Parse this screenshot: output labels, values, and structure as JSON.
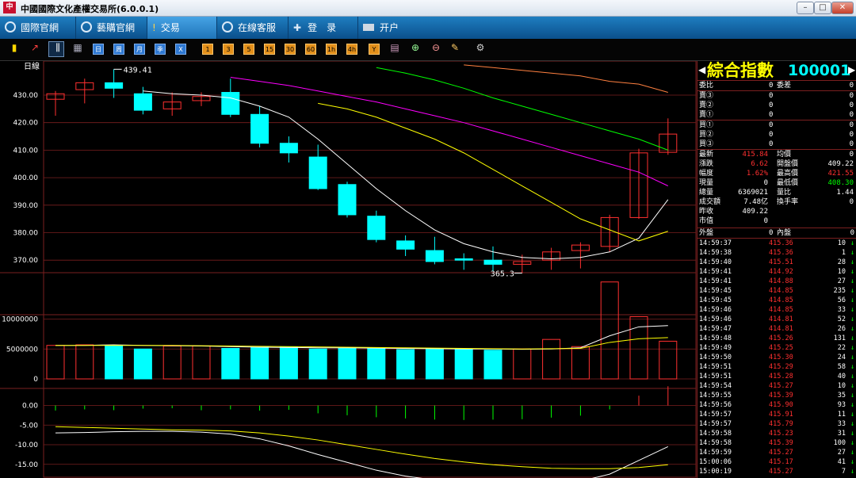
{
  "window": {
    "title": "中國國際文化產權交易所(6.0.0.1)",
    "logo_text": "中",
    "min": "–",
    "max": "□",
    "close": "✕"
  },
  "menu": [
    {
      "label": "國際官網",
      "icon": "globe-icon"
    },
    {
      "label": "藝購官網",
      "icon": "link-icon"
    },
    {
      "label": "交易",
      "icon": "trade-icon"
    },
    {
      "label": "在線客服",
      "icon": "service-icon"
    },
    {
      "label": "登　录",
      "icon": "login-icon"
    },
    {
      "label": "开户",
      "icon": "account-icon"
    }
  ],
  "toolbar": {
    "periods": [
      "日",
      "周",
      "月",
      "季",
      "X"
    ],
    "counts": [
      "1",
      "3",
      "5",
      "15",
      "30",
      "60",
      "1h",
      "4h",
      "Y"
    ]
  },
  "chart": {
    "period_label": "日線",
    "price_ticks": [
      "430.00",
      "420.00",
      "410.00",
      "400.00",
      "390.00",
      "380.00",
      "370.00"
    ],
    "vol_ticks": [
      "10000000",
      "5000000",
      "0"
    ],
    "macd_ticks": [
      "0.00",
      "-5.00",
      "-10.00",
      "-15.00"
    ],
    "max_label": "439.41",
    "min_label": "365.3",
    "candles": [
      [
        428.5,
        430.5,
        431.5,
        422.5
      ],
      [
        432,
        434.5,
        436,
        427
      ],
      [
        434.5,
        432.5,
        439.41,
        429
      ],
      [
        430.5,
        424.5,
        433,
        423
      ],
      [
        425,
        427.5,
        431,
        422.5
      ],
      [
        428,
        429.5,
        431,
        426
      ],
      [
        431,
        423,
        436,
        422
      ],
      [
        423,
        412.5,
        426,
        411
      ],
      [
        412.5,
        409,
        415,
        405.5
      ],
      [
        407.5,
        396,
        412,
        395.5
      ],
      [
        397.5,
        386.5,
        398.5,
        385.5
      ],
      [
        386,
        377.5,
        388,
        376.5
      ],
      [
        377,
        374,
        379,
        371.5
      ],
      [
        373.5,
        369.5,
        378.5,
        368.5
      ],
      [
        370.5,
        370,
        372.5,
        366.5
      ],
      [
        370,
        368.5,
        375,
        366
      ],
      [
        368.5,
        369.5,
        372,
        365.3
      ],
      [
        370,
        373,
        374.5,
        366.5
      ],
      [
        373.5,
        375.5,
        376.5,
        367
      ],
      [
        375,
        385.5,
        386.5,
        373
      ],
      [
        385.5,
        409,
        410.5,
        385
      ],
      [
        409.22,
        415.84,
        421.55,
        408.3
      ]
    ],
    "volumes": [
      5.6,
      5.7,
      5.6,
      5.0,
      5.5,
      5.5,
      5.1,
      5.3,
      5.3,
      5.0,
      5.1,
      5.1,
      4.9,
      5.0,
      5.0,
      4.8,
      5.0,
      6.6,
      5.4,
      16.2,
      10.4,
      6.3
    ],
    "volume_unit": 1000000,
    "ma5": [
      null,
      null,
      null,
      431.5,
      430.5,
      430,
      429,
      426,
      422,
      414,
      405,
      396,
      388,
      381,
      376,
      373,
      371,
      370.5,
      371,
      373,
      378,
      392
    ],
    "ma10": [
      null,
      null,
      null,
      null,
      null,
      null,
      null,
      null,
      null,
      427,
      425,
      422,
      418,
      414,
      409,
      403,
      397,
      391,
      385,
      381,
      377,
      380.5
    ],
    "ma20": [
      null,
      null,
      null,
      null,
      null,
      null,
      436.5,
      435,
      433.5,
      431.5,
      429.5,
      427.5,
      425,
      422.5,
      420,
      417,
      414,
      411,
      408,
      405,
      402,
      397
    ],
    "ma30": [
      null,
      null,
      null,
      null,
      null,
      null,
      null,
      null,
      null,
      null,
      null,
      440,
      438,
      435.5,
      432.5,
      429,
      426,
      423,
      420,
      417,
      414,
      410
    ],
    "ma60": [
      null,
      null,
      null,
      null,
      null,
      null,
      null,
      null,
      null,
      null,
      null,
      null,
      null,
      null,
      441,
      440,
      439,
      438,
      437,
      435,
      434,
      431
    ],
    "vol_ma5": [
      5.6,
      5.6,
      5.7,
      5.6,
      5.55,
      5.5,
      5.4,
      5.3,
      5.25,
      5.2,
      5.2,
      5.15,
      5.1,
      5.05,
      5.0,
      5.0,
      4.95,
      5.0,
      5.2,
      7.2,
      8.7,
      8.9
    ],
    "vol_ma10": [
      5.6,
      5.6,
      5.6,
      5.6,
      5.6,
      5.55,
      5.5,
      5.45,
      5.4,
      5.35,
      5.3,
      5.25,
      5.2,
      5.15,
      5.1,
      5.05,
      5.0,
      5.05,
      5.1,
      6.1,
      6.7,
      6.9
    ],
    "macd_bars": [
      -1.3,
      -1.0,
      -1.2,
      -0.8,
      -0.7,
      -1.2,
      -1.0,
      -1.3,
      -1.1,
      -2.0,
      -2.5,
      -3.0,
      -3.3,
      -3.6,
      -3.7,
      -3.6,
      -3.5,
      -3.1,
      -2.6,
      -1.0,
      2.5,
      4.9
    ],
    "dif": [
      -7,
      -6.9,
      -6.7,
      -6.6,
      -6.6,
      -6.8,
      -7.3,
      -8.5,
      -10.3,
      -12.5,
      -14.5,
      -16.5,
      -18,
      -19,
      -19.8,
      -20,
      -20.1,
      -19.9,
      -19.3,
      -17.5,
      -14,
      -10.5
    ],
    "dea": [
      -5.4,
      -5.6,
      -5.8,
      -6,
      -6.2,
      -6.3,
      -6.5,
      -7,
      -7.8,
      -8.8,
      -10,
      -11.2,
      -12.4,
      -13.5,
      -14.4,
      -15.1,
      -15.6,
      -16,
      -16.1,
      -16.1,
      -15.8,
      -15.1
    ]
  },
  "quote": {
    "name": "綜合指數",
    "code": "100001",
    "weibi_label": "委比",
    "weibi": "0",
    "weicha_label": "委差",
    "weicha": "0",
    "sell": [
      {
        "label": "賣③",
        "price": "0",
        "vol": "0"
      },
      {
        "label": "賣②",
        "price": "0",
        "vol": "0"
      },
      {
        "label": "賣①",
        "price": "0",
        "vol": "0"
      }
    ],
    "buy": [
      {
        "label": "買①",
        "price": "0",
        "vol": "0"
      },
      {
        "label": "買②",
        "price": "0",
        "vol": "0"
      },
      {
        "label": "買③",
        "price": "0",
        "vol": "0"
      }
    ],
    "rows": [
      [
        "最新",
        "415.84",
        "均價",
        "0"
      ],
      [
        "漲跌",
        "6.62",
        "開盤價",
        "409.22"
      ],
      [
        "幅度",
        "1.62%",
        "最高價",
        "421.55"
      ],
      [
        "現量",
        "0",
        "最低價",
        "408.30"
      ],
      [
        "總量",
        "6369021",
        "量比",
        "1.44"
      ],
      [
        "成交額",
        "7.48亿",
        "換手率",
        "0"
      ],
      [
        "昨收",
        "409.22",
        "",
        ""
      ],
      [
        "市值",
        "0",
        "",
        ""
      ]
    ],
    "outer_label": "外盤",
    "outer": "0",
    "inner_label": "內盤",
    "inner": "0",
    "ticks": [
      [
        "14:59:37",
        "415.36",
        "10"
      ],
      [
        "14:59:38",
        "415.36",
        "1"
      ],
      [
        "14:59:40",
        "415.51",
        "28"
      ],
      [
        "14:59:41",
        "414.92",
        "10"
      ],
      [
        "14:59:41",
        "414.88",
        "27"
      ],
      [
        "14:59:45",
        "414.85",
        "235"
      ],
      [
        "14:59:45",
        "414.85",
        "56"
      ],
      [
        "14:59:46",
        "414.85",
        "33"
      ],
      [
        "14:59:46",
        "414.81",
        "52"
      ],
      [
        "14:59:47",
        "414.81",
        "26"
      ],
      [
        "14:59:48",
        "415.26",
        "131"
      ],
      [
        "14:59:49",
        "415.25",
        "22"
      ],
      [
        "14:59:50",
        "415.30",
        "24"
      ],
      [
        "14:59:51",
        "415.29",
        "58"
      ],
      [
        "14:59:51",
        "415.28",
        "40"
      ],
      [
        "14:59:54",
        "415.27",
        "10"
      ],
      [
        "14:59:55",
        "415.39",
        "35"
      ],
      [
        "14:59:56",
        "415.90",
        "93"
      ],
      [
        "14:59:57",
        "415.91",
        "11"
      ],
      [
        "14:59:57",
        "415.79",
        "33"
      ],
      [
        "14:59:58",
        "415.23",
        "31"
      ],
      [
        "14:59:58",
        "415.39",
        "100"
      ],
      [
        "14:59:59",
        "415.27",
        "27"
      ],
      [
        "15:00:06",
        "415.17",
        "41"
      ],
      [
        "15:00:19",
        "415.27",
        "7"
      ]
    ],
    "tick_arrow": "↓"
  },
  "colors": {
    "up": "#ff3030",
    "down": "#00ffff",
    "ma5": "#ffffff",
    "ma10": "#ffff00",
    "ma20": "#ff00ff",
    "ma30": "#00ff00",
    "ma60": "#ff8040",
    "grid": "#7a1f1f"
  }
}
